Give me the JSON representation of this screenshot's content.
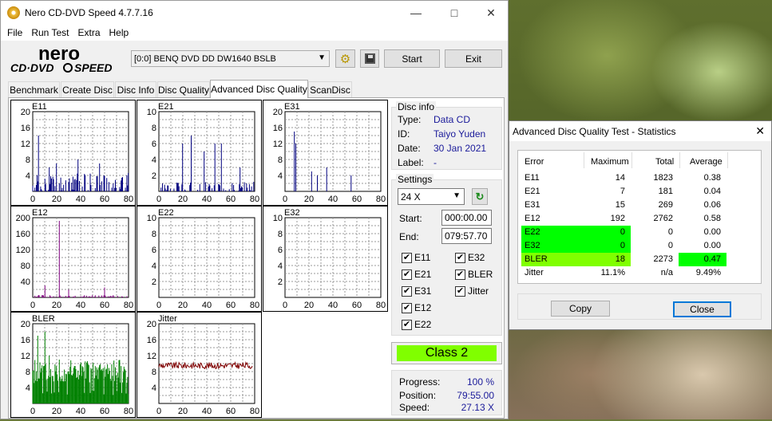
{
  "main_window": {
    "title": "Nero CD-DVD Speed 4.7.7.16",
    "menu": [
      "File",
      "Run Test",
      "Extra",
      "Help"
    ],
    "drive": "[0:0]   BENQ DVD DD DW1640 BSLB",
    "start_label": "Start",
    "exit_label": "Exit",
    "tabs": [
      "Benchmark",
      "Create Disc",
      "Disc Info",
      "Disc Quality",
      "Advanced Disc Quality",
      "ScanDisc"
    ],
    "active_tab": "Advanced Disc Quality"
  },
  "disc_info": {
    "group_label": "Disc info",
    "type_label": "Type:",
    "type_value": "Data CD",
    "id_label": "ID:",
    "id_value": "Taiyo Yuden",
    "date_label": "Date:",
    "date_value": "30 Jan 2021",
    "label_label": "Label:",
    "label_value": "-"
  },
  "settings": {
    "group_label": "Settings",
    "speed": "24 X",
    "start_label": "Start:",
    "start_value": "000:00.00",
    "end_label": "End:",
    "end_value": "079:57.70",
    "checks_left": [
      "E11",
      "E21",
      "E31",
      "E12",
      "E22"
    ],
    "checks_right": [
      "E32",
      "BLER",
      "Jitter"
    ]
  },
  "class_badge": "Class 2",
  "progress": {
    "progress_label": "Progress:",
    "progress_value": "100 %",
    "position_label": "Position:",
    "position_value": "79:55.00",
    "speed_label": "Speed:",
    "speed_value": "27.13 X"
  },
  "chart_data": [
    {
      "type": "bar",
      "title": "E11",
      "ylim": [
        0,
        20
      ],
      "yticks": [
        "20",
        "16",
        "12",
        "8",
        "4"
      ],
      "xticks": [
        "0",
        "20",
        "40",
        "60",
        "80"
      ],
      "color": "#00007f",
      "seed": 11,
      "level": 4,
      "peaks": [
        [
          5,
          14
        ],
        [
          14,
          6
        ],
        [
          20,
          7
        ],
        [
          38,
          8
        ],
        [
          56,
          7
        ]
      ]
    },
    {
      "type": "bar",
      "title": "E21",
      "ylim": [
        0,
        10
      ],
      "yticks": [
        "10",
        "8",
        "6",
        "4",
        "2"
      ],
      "xticks": [
        "0",
        "20",
        "40",
        "60",
        "80"
      ],
      "color": "#00007f",
      "seed": 21,
      "level": 1,
      "peaks": [
        [
          20,
          6
        ],
        [
          27,
          7
        ],
        [
          38,
          5
        ],
        [
          47,
          6
        ],
        [
          52,
          6
        ],
        [
          68,
          3
        ]
      ]
    },
    {
      "type": "bar",
      "title": "E31",
      "ylim": [
        0,
        20
      ],
      "yticks": [
        "20",
        "16",
        "12",
        "8",
        "4"
      ],
      "xticks": [
        "0",
        "20",
        "40",
        "60",
        "80"
      ],
      "color": "#00007f",
      "seed": 31,
      "level": 0,
      "peaks": [
        [
          8,
          15
        ],
        [
          9,
          12
        ],
        [
          22,
          5
        ],
        [
          27,
          4
        ],
        [
          35,
          6
        ],
        [
          55,
          4
        ]
      ]
    },
    {
      "type": "bar",
      "title": "E12",
      "ylim": [
        0,
        200
      ],
      "yticks": [
        "200",
        "160",
        "120",
        "80",
        "40"
      ],
      "xticks": [
        "0",
        "20",
        "40",
        "60",
        "80"
      ],
      "color": "#7f007f",
      "seed": 12,
      "level": 5,
      "peaks": [
        [
          22,
          192
        ],
        [
          10,
          30
        ],
        [
          30,
          20
        ],
        [
          60,
          25
        ]
      ]
    },
    {
      "type": "bar",
      "title": "E22",
      "ylim": [
        0,
        10
      ],
      "yticks": [
        "10",
        "8",
        "6",
        "4",
        "2"
      ],
      "xticks": [
        "0",
        "20",
        "40",
        "60",
        "80"
      ],
      "color": "#7f007f",
      "seed": 22,
      "level": 0,
      "peaks": []
    },
    {
      "type": "bar",
      "title": "E32",
      "ylim": [
        0,
        10
      ],
      "yticks": [
        "10",
        "8",
        "6",
        "4",
        "2"
      ],
      "xticks": [
        "0",
        "20",
        "40",
        "60",
        "80"
      ],
      "color": "#7f007f",
      "seed": 32,
      "level": 0,
      "peaks": []
    },
    {
      "type": "bar",
      "title": "BLER",
      "ylim": [
        0,
        20
      ],
      "yticks": [
        "20",
        "16",
        "12",
        "8",
        "4"
      ],
      "xticks": [
        "0",
        "20",
        "40",
        "60",
        "80"
      ],
      "color": "#008000",
      "seed": 5,
      "level": 5,
      "peaks": [
        [
          4,
          17
        ],
        [
          10,
          18
        ],
        [
          14,
          12
        ],
        [
          22,
          11
        ],
        [
          30,
          8
        ]
      ]
    },
    {
      "type": "line",
      "title": "Jitter",
      "ylim": [
        0,
        20
      ],
      "yticks": [
        "20",
        "16",
        "12",
        "8",
        "4"
      ],
      "xticks": [
        "0",
        "20",
        "40",
        "60",
        "80"
      ],
      "color": "#7f0000",
      "seed": 9,
      "level": 9.5,
      "peaks": []
    }
  ],
  "stats_window": {
    "title": "Advanced Disc Quality Test - Statistics",
    "headers": [
      "Error",
      "Maximum",
      "Total",
      "Average"
    ],
    "rows": [
      {
        "name": "E11",
        "max": "14",
        "total": "1823",
        "avg": "0.38"
      },
      {
        "name": "E21",
        "max": "7",
        "total": "181",
        "avg": "0.04"
      },
      {
        "name": "E31",
        "max": "15",
        "total": "269",
        "avg": "0.06"
      },
      {
        "name": "E12",
        "max": "192",
        "total": "2762",
        "avg": "0.58"
      },
      {
        "name": "E22",
        "max": "0",
        "total": "0",
        "avg": "0.00"
      },
      {
        "name": "E32",
        "max": "0",
        "total": "0",
        "avg": "0.00"
      },
      {
        "name": "BLER",
        "max": "18",
        "total": "2273",
        "avg": "0.47"
      },
      {
        "name": "Jitter",
        "max": "11.1%",
        "total": "n/a",
        "avg": "9.49%"
      }
    ],
    "copy_label": "Copy",
    "close_label": "Close",
    "colors": {
      "bright_green": "#00ff00",
      "yellow_green": "#80ff00"
    }
  }
}
